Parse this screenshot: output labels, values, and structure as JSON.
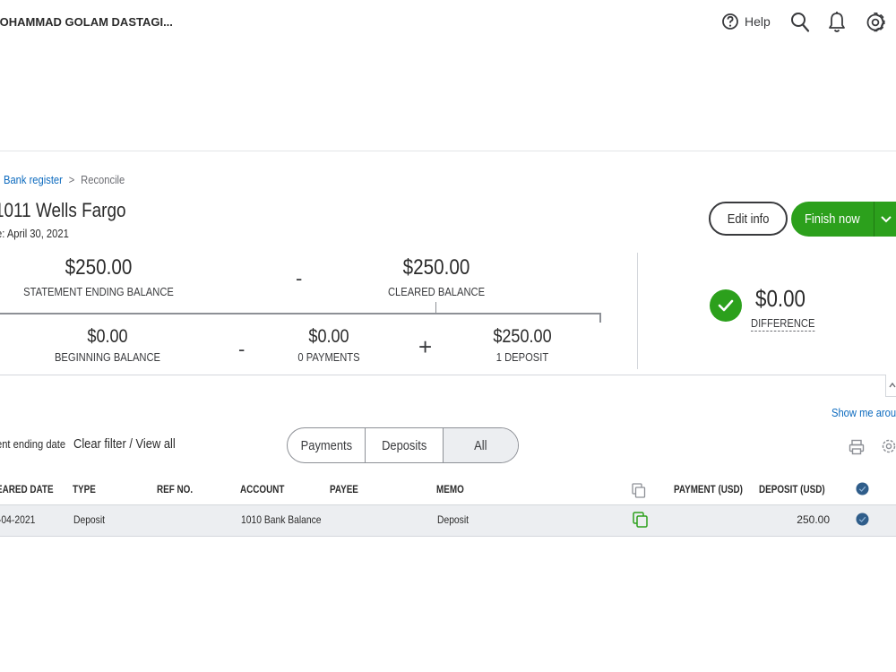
{
  "header": {
    "company_name": "IOHAMMAD GOLAM DASTAGI...",
    "help_label": "Help",
    "icons": [
      "help-circle-icon",
      "search-icon",
      "bell-icon",
      "gear-icon"
    ]
  },
  "breadcrumb": {
    "link": "Bank register",
    "separator": ">",
    "current": "Reconcile"
  },
  "account": {
    "title": "1011 Wells Fargo",
    "statement_date": "e: April 30, 2021"
  },
  "actions": {
    "edit_info": "Edit info",
    "finish_now": "Finish now"
  },
  "summary": {
    "statement_ending_balance": "$250.00",
    "statement_ending_balance_label": "STATEMENT ENDING BALANCE",
    "minus_1": "-",
    "cleared_balance": "$250.00",
    "cleared_balance_label": "CLEARED BALANCE",
    "beginning_balance": "$0.00",
    "beginning_balance_label": "BEGINNING BALANCE",
    "minus_2": "-",
    "payments": "$0.00",
    "payments_label": "0 PAYMENTS",
    "plus": "+",
    "deposits": "$250.00",
    "deposits_label": "1 DEPOSIT",
    "difference": "$0.00",
    "difference_label": "DIFFERENCE"
  },
  "filter": {
    "show_me_around": "Show me arou",
    "ending_date_label": "ent ending date",
    "clear_filter": "Clear filter / View all",
    "tabs": [
      "Payments",
      "Deposits",
      "All"
    ],
    "selected_tab": "All"
  },
  "table": {
    "columns": [
      "EARED DATE",
      "TYPE",
      "REF NO.",
      "ACCOUNT",
      "PAYEE",
      "MEMO",
      "PAYMENT (USD)",
      "DEPOSIT (USD)"
    ],
    "rows": [
      {
        "date": "-04-2021",
        "type": "Deposit",
        "ref_no": "",
        "account": "1010 Bank Balance",
        "payee": "",
        "memo": "Deposit",
        "payment": "",
        "deposit": "250.00",
        "cleared": true
      }
    ]
  },
  "colors": {
    "accent_green": "#2ca01c",
    "link_blue": "#0d6bbf",
    "clear_dot_blue": "#2f5d8a",
    "row_gray": "#eceef1"
  }
}
